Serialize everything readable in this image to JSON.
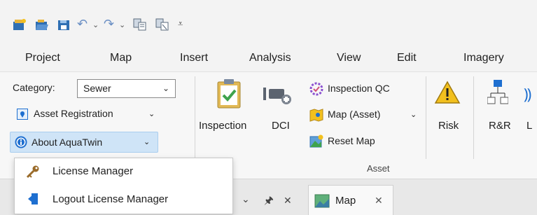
{
  "quick_access": {
    "icons": [
      "new-project-icon",
      "open-project-icon",
      "save-project-icon",
      "undo-icon",
      "undo-dropdown-icon",
      "redo-icon",
      "redo-dropdown-icon",
      "copy-layout-icon",
      "paste-layout-icon",
      "customize-toolbar-icon"
    ]
  },
  "tabs": [
    "Project",
    "Map",
    "Insert",
    "Analysis",
    "View",
    "Edit",
    "Imagery"
  ],
  "ribbon": {
    "category_label": "Category:",
    "category_value": "Sewer",
    "asset_registration_label": "Asset Registration",
    "about_label": "About AquaTwin",
    "inspection_label": "Inspection",
    "dci_label": "DCI",
    "inspection_qc_label": "Inspection QC",
    "map_asset_label": "Map (Asset)",
    "reset_map_label": "Reset Map",
    "risk_label": "Risk",
    "rr_label": "R&R",
    "clipped_label": "L",
    "group_label": "Asset"
  },
  "menu": {
    "items": [
      {
        "label": "License Manager",
        "icon": "key-icon"
      },
      {
        "label": "Logout License Manager",
        "icon": "logout-icon"
      }
    ]
  },
  "pane": {
    "map_tab_label": "Map",
    "pin_glyph": "չ",
    "close_glyph": "✕",
    "chevron_glyph": "⌄"
  },
  "colors": {
    "accent_blue": "#1e6fd0",
    "about_highlight": "#cfe4f7",
    "warning_yellow": "#f2c01e",
    "check_green": "#3fa34d"
  }
}
